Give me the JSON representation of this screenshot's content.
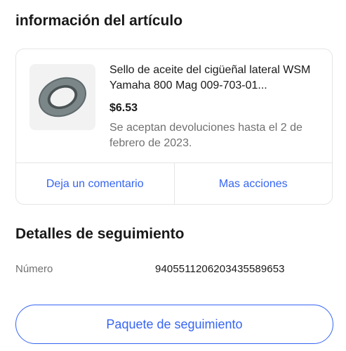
{
  "item_section": {
    "title": "información del artículo",
    "item": {
      "name": "Sello de aceite del cigüeñal lateral WSM Yamaha 800 Mag 009-703-01...",
      "price": "$6.53",
      "returns_note": "Se aceptan devoluciones hasta el 2 de febrero de 2023.",
      "image_icon": "oil-seal-ring-image"
    },
    "actions": {
      "leave_feedback": "Deja un comentario",
      "more_actions": "Mas acciones"
    }
  },
  "tracking_section": {
    "title": "Detalles de seguimiento",
    "number_label": "Número",
    "number_value": "9405511206203435589653",
    "track_button": "Paquete de seguimiento"
  },
  "colors": {
    "accent": "#3665f3",
    "text_primary": "#191919",
    "text_secondary": "#707070",
    "border": "#e5e5e5"
  }
}
